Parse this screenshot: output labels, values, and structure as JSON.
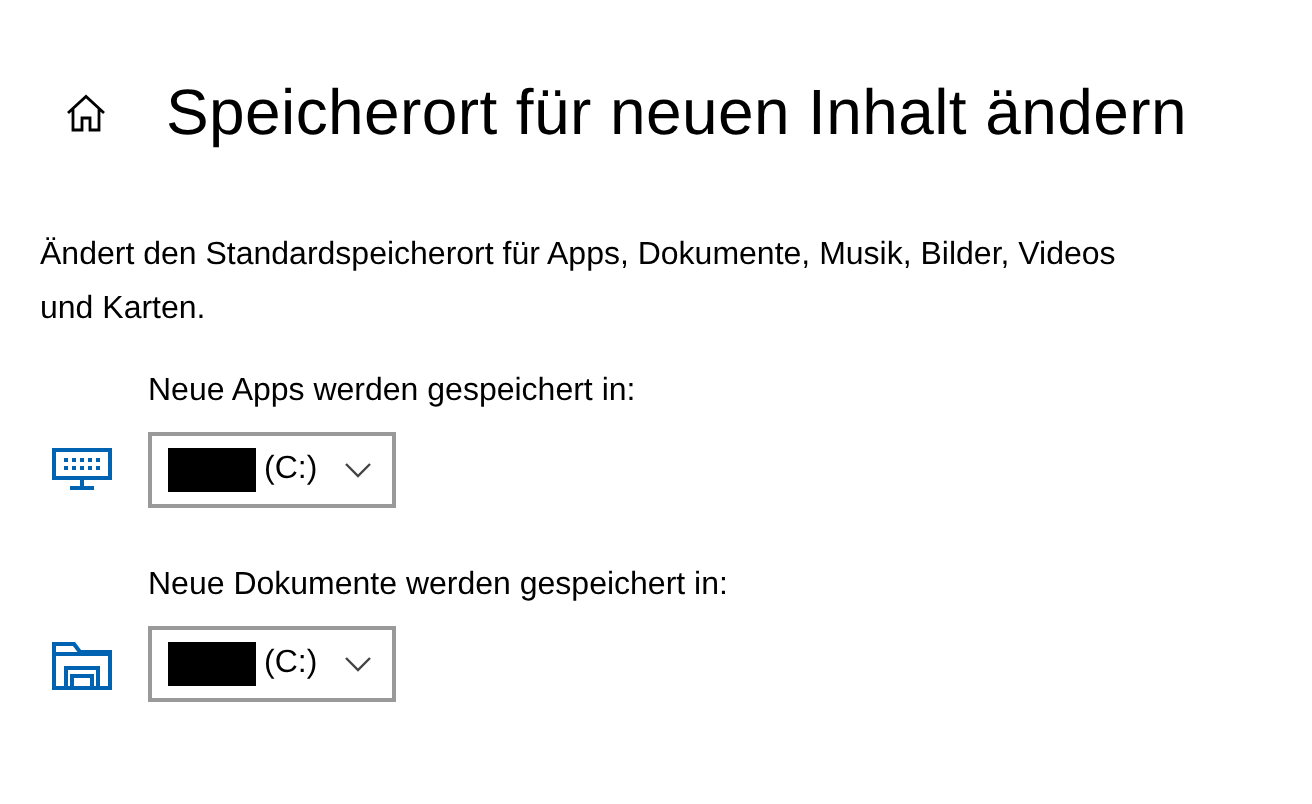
{
  "title": "Speicherort für neuen Inhalt ändern",
  "description": "Ändert den Standardspeicherort für Apps, Dokumente, Musik, Bilder, Videos und Karten.",
  "locations": [
    {
      "kind": "apps",
      "label": "Neue Apps werden gespeichert in:",
      "value": "(C:)"
    },
    {
      "kind": "documents",
      "label": "Neue Dokumente werden gespeichert in:",
      "value": "(C:)"
    }
  ]
}
